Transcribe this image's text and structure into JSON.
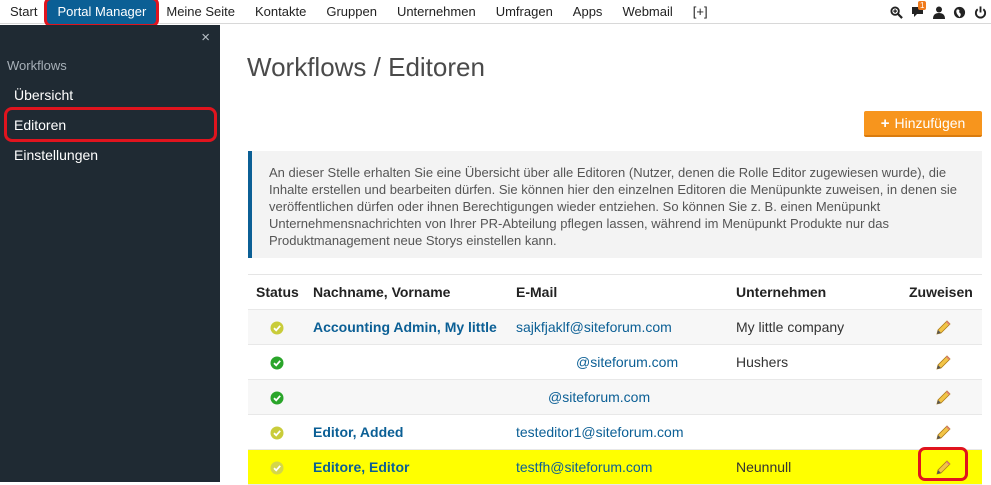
{
  "nav": {
    "items": [
      "Start",
      "Portal Manager",
      "Meine Seite",
      "Kontakte",
      "Gruppen",
      "Unternehmen",
      "Umfragen",
      "Apps",
      "Webmail",
      "[+]"
    ],
    "active_index": 1,
    "notification_count": "1",
    "icons": [
      "search-plus-icon",
      "chat-icon",
      "user-icon",
      "globe-icon",
      "power-icon"
    ]
  },
  "sidebar": {
    "close": "×",
    "heading": "Workflows",
    "items": [
      "Übersicht",
      "Editoren",
      "Einstellungen"
    ],
    "active_index": 1
  },
  "main": {
    "title": "Workflows / Editoren",
    "add_button_label": "Hinzufügen",
    "info_text": "An dieser Stelle erhalten Sie eine Übersicht über alle Editoren (Nutzer, denen die Rolle Editor zugewiesen wurde), die Inhalte erstellen und bearbeiten dürfen. Sie können hier den einzelnen Editoren die Menüpunkte zuweisen, in denen sie veröffentlichen dürfen oder ihnen Berechtigungen wieder entziehen. So können Sie z. B. einen Menüpunkt Unternehmensnachrichten von Ihrer PR-Abteilung pflegen lassen, während im Menüpunkt Produkte nur das Produktmanagement neue Storys einstellen kann."
  },
  "table": {
    "headers": {
      "status": "Status",
      "name": "Nachname, Vorname",
      "email": "E-Mail",
      "company": "Unternehmen",
      "assign": "Zuweisen"
    },
    "rows": [
      {
        "status": "pending",
        "name": "Accounting Admin, My little",
        "email": "sajkfjaklf@siteforum.com",
        "company": "My little company"
      },
      {
        "status": "active",
        "name": "",
        "email": "@siteforum.com",
        "company": "Hushers"
      },
      {
        "status": "active",
        "name": "",
        "email": "@siteforum.com",
        "company": ""
      },
      {
        "status": "pending",
        "name": "Editor, Added",
        "email": "testeditor1@siteforum.com",
        "company": ""
      },
      {
        "status": "pending",
        "name": "Editore, Editor",
        "email": "testfh@siteforum.com",
        "company": "Neunnull"
      }
    ],
    "highlight_row": 4
  },
  "colors": {
    "nav_active": "#0b5f95",
    "sidebar_bg": "#1f2a33",
    "accent_orange": "#f7951d",
    "link": "#0b5f95",
    "status_active": "#2aa52a",
    "status_pending": "#c9cc3a",
    "row_highlight": "#ffff00",
    "annotation_red": "#e0141e"
  }
}
